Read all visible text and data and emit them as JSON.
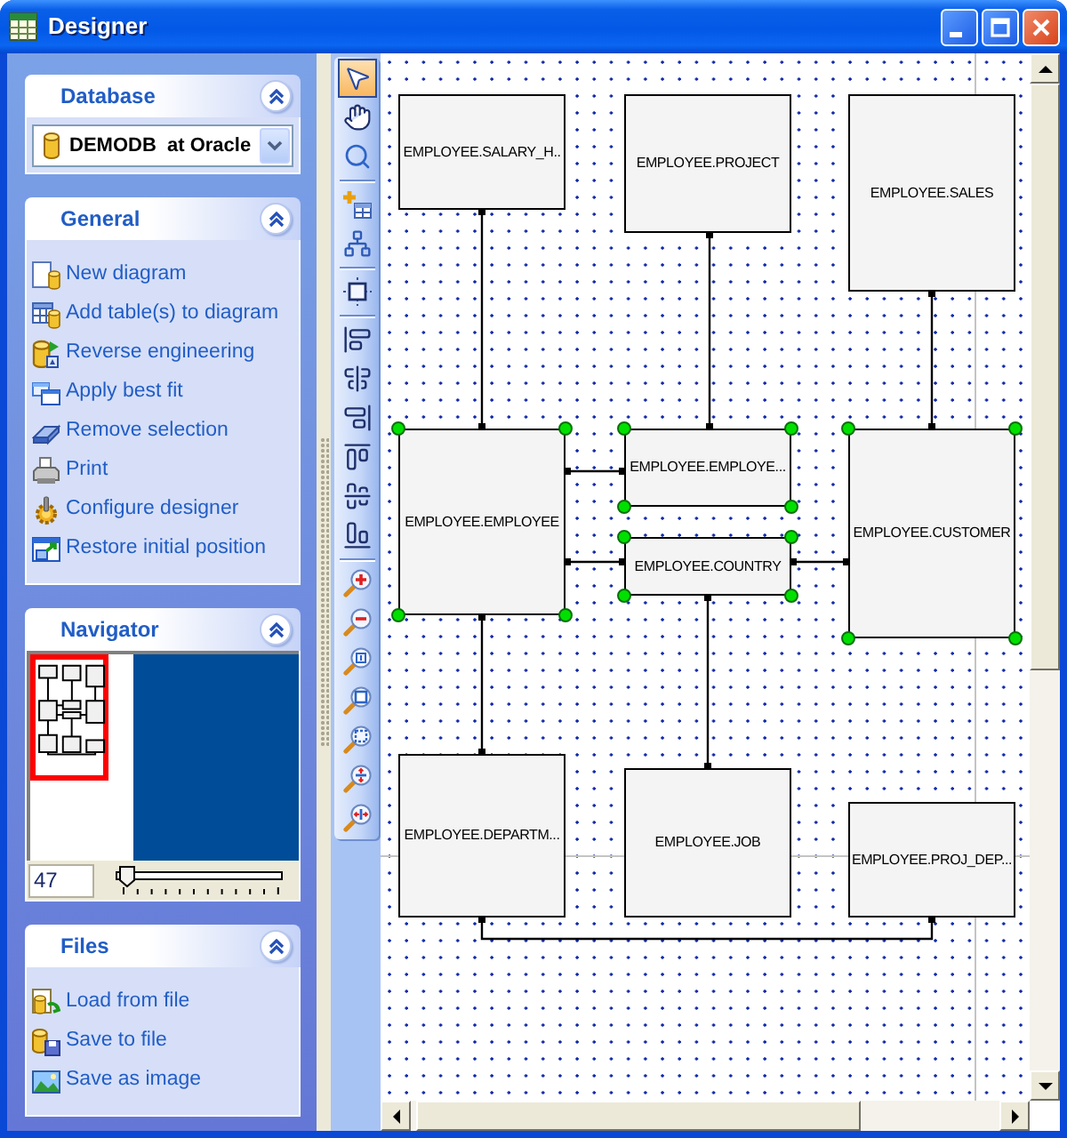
{
  "window": {
    "title": "Designer"
  },
  "sidebar": {
    "panels": [
      {
        "kind": "database",
        "title": "Database",
        "expanded": true,
        "database": "DEMODB  at Oracle"
      },
      {
        "kind": "links",
        "title": "General",
        "expanded": true,
        "items": [
          "New diagram",
          "Add table(s) to diagram",
          "Reverse engineering",
          "Apply best fit",
          "Remove selection",
          "Print",
          "Configure designer",
          "Restore initial position"
        ]
      },
      {
        "kind": "navigator",
        "title": "Navigator",
        "expanded": true,
        "zoom": "47",
        "zoom_slider": {
          "level": 0.02
        }
      },
      {
        "kind": "links",
        "title": "Files",
        "expanded": true,
        "items": [
          "Load from file",
          "Save to file",
          "Save as image"
        ]
      }
    ]
  },
  "toolbar": {
    "groups": [
      {
        "tools": [
          {
            "kind": "pointer",
            "selected": true
          },
          {
            "kind": "hand",
            "selected": false
          },
          {
            "kind": "zoom",
            "selected": false
          }
        ]
      },
      {
        "tools": [
          {
            "kind": "add_table",
            "selected": false
          },
          {
            "kind": "layout",
            "selected": false
          }
        ]
      },
      {
        "tools": [
          {
            "kind": "fit",
            "selected": false
          }
        ]
      },
      {
        "tools": [
          {
            "kind": "align_left",
            "selected": false
          },
          {
            "kind": "align_center",
            "selected": false
          },
          {
            "kind": "align_right",
            "selected": false
          },
          {
            "kind": "align_top",
            "selected": false
          },
          {
            "kind": "align_middle",
            "selected": false
          },
          {
            "kind": "align_bottom",
            "selected": false
          }
        ]
      },
      {
        "tools": [
          {
            "kind": "zoom_in",
            "selected": false
          },
          {
            "kind": "zoom_out",
            "selected": false
          },
          {
            "kind": "zoom_actual",
            "selected": false
          },
          {
            "kind": "zoom_fit",
            "selected": false
          },
          {
            "kind": "zoom_selection",
            "selected": false
          },
          {
            "kind": "zoom_height",
            "selected": false
          },
          {
            "kind": "zoom_width",
            "selected": false
          }
        ]
      }
    ]
  },
  "diagram": {
    "tables": [
      {
        "name": "EMPLOYEE.SALARY_H..",
        "selected": false
      },
      {
        "name": "EMPLOYEE.PROJECT",
        "selected": false
      },
      {
        "name": "EMPLOYEE.SALES",
        "selected": false
      },
      {
        "name": "EMPLOYEE.EMPLOYEE",
        "selected": true
      },
      {
        "name": "EMPLOYEE.EMPLOYE...",
        "selected": true
      },
      {
        "name": "EMPLOYEE.COUNTRY",
        "selected": true
      },
      {
        "name": "EMPLOYEE.CUSTOMER",
        "selected": true
      },
      {
        "name": "EMPLOYEE.DEPARTM...",
        "selected": false
      },
      {
        "name": "EMPLOYEE.JOB",
        "selected": false
      },
      {
        "name": "EMPLOYEE.PROJ_DEP...",
        "selected": false
      }
    ]
  }
}
